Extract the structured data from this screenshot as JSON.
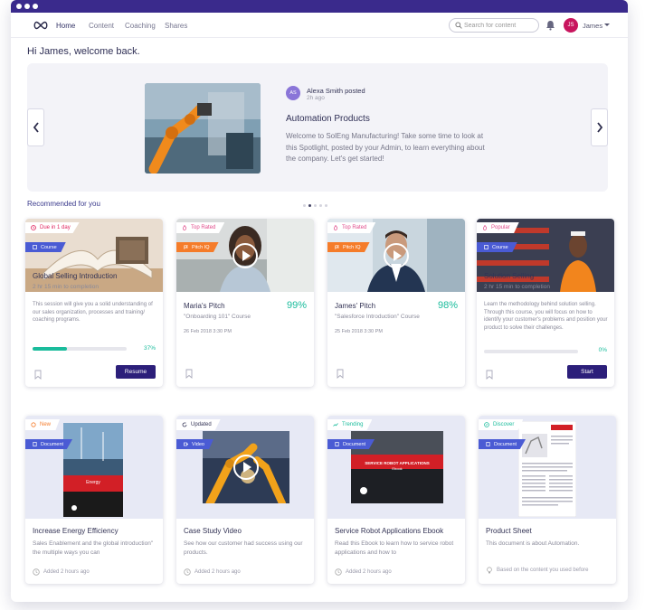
{
  "nav": {
    "links": [
      "Home",
      "Content",
      "Coaching",
      "Shares"
    ],
    "search_placeholder": "Search for content",
    "avatar_initials": "JS",
    "username": "James"
  },
  "welcome": "Hi James, welcome back.",
  "spotlight": {
    "avatar_initials": "AS",
    "author": "Alexa Smith posted",
    "time": "2h ago",
    "title": "Automation Products",
    "body": "Welcome to SolEng Manufacturing! Take some time to look at this Spotlight, posted by your Admin, to learn everything about the company. Let's get started!"
  },
  "recommended_title": "Recommended for you",
  "colors": {
    "accent": "#2c1f7a",
    "green": "#1abc9c",
    "blue_tag": "#4a5bd4",
    "orange_tag": "#f57c2a",
    "red_badge": "#e0245e",
    "pink_badge": "#e04a8a"
  },
  "cards_row1": [
    {
      "badge": "Due in 1 day",
      "type": "Course",
      "title": "Global Selling Introduction",
      "meta": "2 hr 15 min to completion",
      "desc": "This session will give you a solid understanding of our sales organization, processes and training/ coaching programs.",
      "progress_pct": "37%",
      "progress": 0.37,
      "button": "Resume"
    },
    {
      "badge": "Top Rated",
      "type": "Pitch IQ",
      "title": "Maria's Pitch",
      "score": "99%",
      "meta": "\"Onboarding 101\" Course",
      "date": "26 Feb 2018 3:30 PM"
    },
    {
      "badge": "Top Rated",
      "type": "Pitch IQ",
      "title": "James' Pitch",
      "score": "98%",
      "meta": "\"Salesforce Introduction\" Course",
      "date": "25 Feb 2018 3:30 PM"
    },
    {
      "badge": "Popular",
      "type": "Course",
      "title": "Solution Selling",
      "meta": "2 hr 15 min to completion",
      "desc": "Learn the methodology behind solution selling. Through this course, you will focus on how to identify your customer's problems and position your product to solve their challenges.",
      "progress_pct": "0%",
      "progress": 0,
      "button": "Start"
    }
  ],
  "cards_row2": [
    {
      "badge": "New",
      "type": "Document",
      "title": "Increase Energy Efficiency",
      "desc": "Sales Enablement and the global introduction\" the multiple ways you can",
      "footer": "Added 2 hours ago",
      "thumb_title": "Energy"
    },
    {
      "badge": "Updated",
      "type": "Video",
      "title": "Case Study Video",
      "desc": "See how our customer had success using our products.",
      "footer": "Added 2 hours ago"
    },
    {
      "badge": "Trending",
      "type": "Document",
      "title": "Service Robot Applications Ebook",
      "desc": "Read this Ebook to learn how to service robot applications and how to",
      "footer": "Added 2 hours ago",
      "thumb_title": "SERVICE ROBOT APPLICATIONS",
      "thumb_sub": "Ebook"
    },
    {
      "badge": "Discover",
      "type": "Document",
      "title": "Product Sheet",
      "desc": "This document is about Automation.",
      "footer": "Based on the content you used before"
    }
  ]
}
